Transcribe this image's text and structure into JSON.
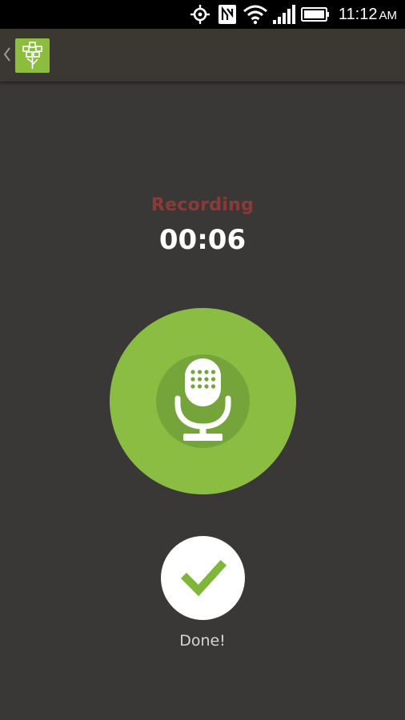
{
  "status_bar": {
    "time": "11:12",
    "ampm": "AM",
    "icons": [
      "gps-icon",
      "nfc-icon",
      "wifi-icon",
      "signal-icon",
      "battery-icon"
    ]
  },
  "action_bar": {
    "back_icon": "chevron-left-icon",
    "logo_icon": "tree-logo-icon"
  },
  "recording": {
    "status_label": "Recording",
    "timer": "00:06",
    "mic_icon": "microphone-icon"
  },
  "done": {
    "label": "Done!",
    "icon": "checkmark-icon"
  },
  "colors": {
    "background": "#3a3836",
    "accent_green": "#8bbd42",
    "recording_red": "#8b3b37",
    "text_white": "#ffffff"
  }
}
